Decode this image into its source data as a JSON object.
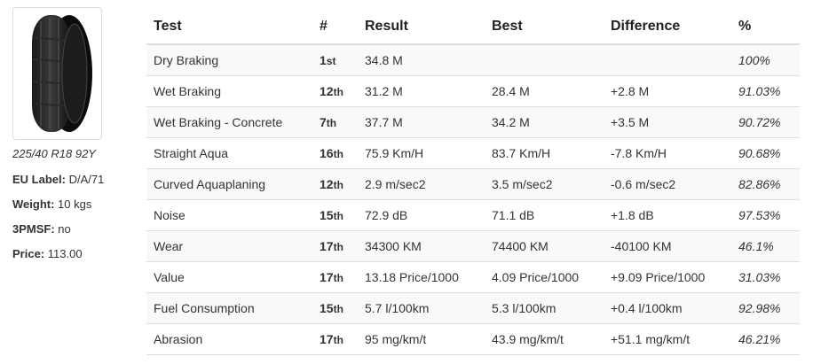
{
  "tyre": {
    "size": "225/40 R18 92Y",
    "eu_label_key": "EU Label:",
    "eu_label_value": "D/A/71",
    "weight_key": "Weight:",
    "weight_value": "10 kgs",
    "threepmsf_key": "3PMSF:",
    "threepmsf_value": "no",
    "price_key": "Price:",
    "price_value": "113.00",
    "image_icon": "tyre-icon"
  },
  "table": {
    "headers": [
      "Test",
      "#",
      "Result",
      "Best",
      "Difference",
      "%"
    ],
    "rows": [
      {
        "test": "Dry Braking",
        "rank": "1",
        "suffix": "st",
        "result": "34.8 M",
        "best": "",
        "difference": "",
        "percent": "100%"
      },
      {
        "test": "Wet Braking",
        "rank": "12",
        "suffix": "th",
        "result": "31.2 M",
        "best": "28.4 M",
        "difference": "+2.8 M",
        "percent": "91.03%"
      },
      {
        "test": "Wet Braking - Concrete",
        "rank": "7",
        "suffix": "th",
        "result": "37.7 M",
        "best": "34.2 M",
        "difference": "+3.5 M",
        "percent": "90.72%"
      },
      {
        "test": "Straight Aqua",
        "rank": "16",
        "suffix": "th",
        "result": "75.9 Km/H",
        "best": "83.7 Km/H",
        "difference": "-7.8 Km/H",
        "percent": "90.68%"
      },
      {
        "test": "Curved Aquaplaning",
        "rank": "12",
        "suffix": "th",
        "result": "2.9 m/sec2",
        "best": "3.5 m/sec2",
        "difference": "-0.6 m/sec2",
        "percent": "82.86%"
      },
      {
        "test": "Noise",
        "rank": "15",
        "suffix": "th",
        "result": "72.9 dB",
        "best": "71.1 dB",
        "difference": "+1.8 dB",
        "percent": "97.53%"
      },
      {
        "test": "Wear",
        "rank": "17",
        "suffix": "th",
        "result": "34300 KM",
        "best": "74400 KM",
        "difference": "-40100 KM",
        "percent": "46.1%"
      },
      {
        "test": "Value",
        "rank": "17",
        "suffix": "th",
        "result": "13.18 Price/1000",
        "best": "4.09 Price/1000",
        "difference": "+9.09 Price/1000",
        "percent": "31.03%"
      },
      {
        "test": "Fuel Consumption",
        "rank": "15",
        "suffix": "th",
        "result": "5.7 l/100km",
        "best": "5.3 l/100km",
        "difference": "+0.4 l/100km",
        "percent": "92.98%"
      },
      {
        "test": "Abrasion",
        "rank": "17",
        "suffix": "th",
        "result": "95 mg/km/t",
        "best": "43.9 mg/km/t",
        "difference": "+51.1 mg/km/t",
        "percent": "46.21%"
      }
    ]
  }
}
